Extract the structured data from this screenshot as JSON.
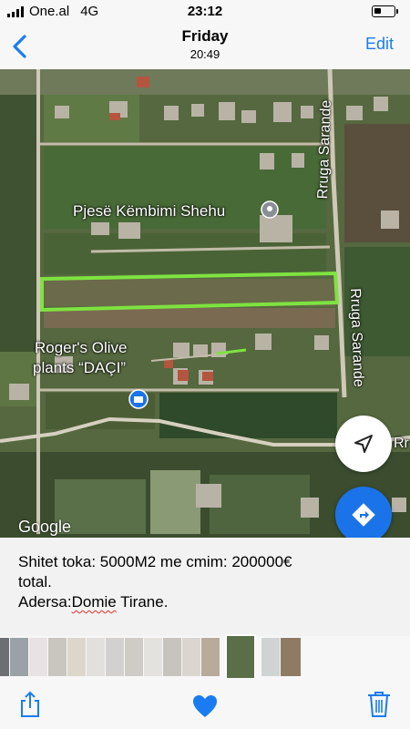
{
  "status": {
    "carrier": "One.al",
    "network": "4G",
    "time": "23:12",
    "battery_level": 0.35
  },
  "nav": {
    "title": "Friday",
    "subtitle": "20:49",
    "edit_label": "Edit"
  },
  "map": {
    "places": [
      {
        "name": "Pjesë Këmbimi Shehu",
        "icon": "map-pin-icon"
      },
      {
        "name": "Roger's Olive plants “DAÇI”",
        "icon": "shopping-bag-pin-icon"
      }
    ],
    "place1_line1": "Pjesë Këmbimi Shehu",
    "place2_line1": "Roger's Olive",
    "place2_line2": "plants “DAÇI”",
    "road_label_1": "Rruga Sarande",
    "road_label_2": "Rruga Sarande",
    "road_label_3": "Rr",
    "attribution": "Google",
    "highlight_color": "#7ee33f",
    "locate_icon": "navigation-arrow-icon",
    "directions_icon": "directions-icon"
  },
  "caption": {
    "line1": "Shitet toka: 5000M2 me cmim: 200000€",
    "line2": "total.",
    "line3_prefix": "Adersa:",
    "line3_misspelled": "Domie",
    "line3_suffix": " Tirane."
  },
  "toolbar": {
    "share_icon": "share-icon",
    "favorite_icon": "heart-icon",
    "delete_icon": "trash-icon",
    "accent": "#1a7cf0"
  }
}
